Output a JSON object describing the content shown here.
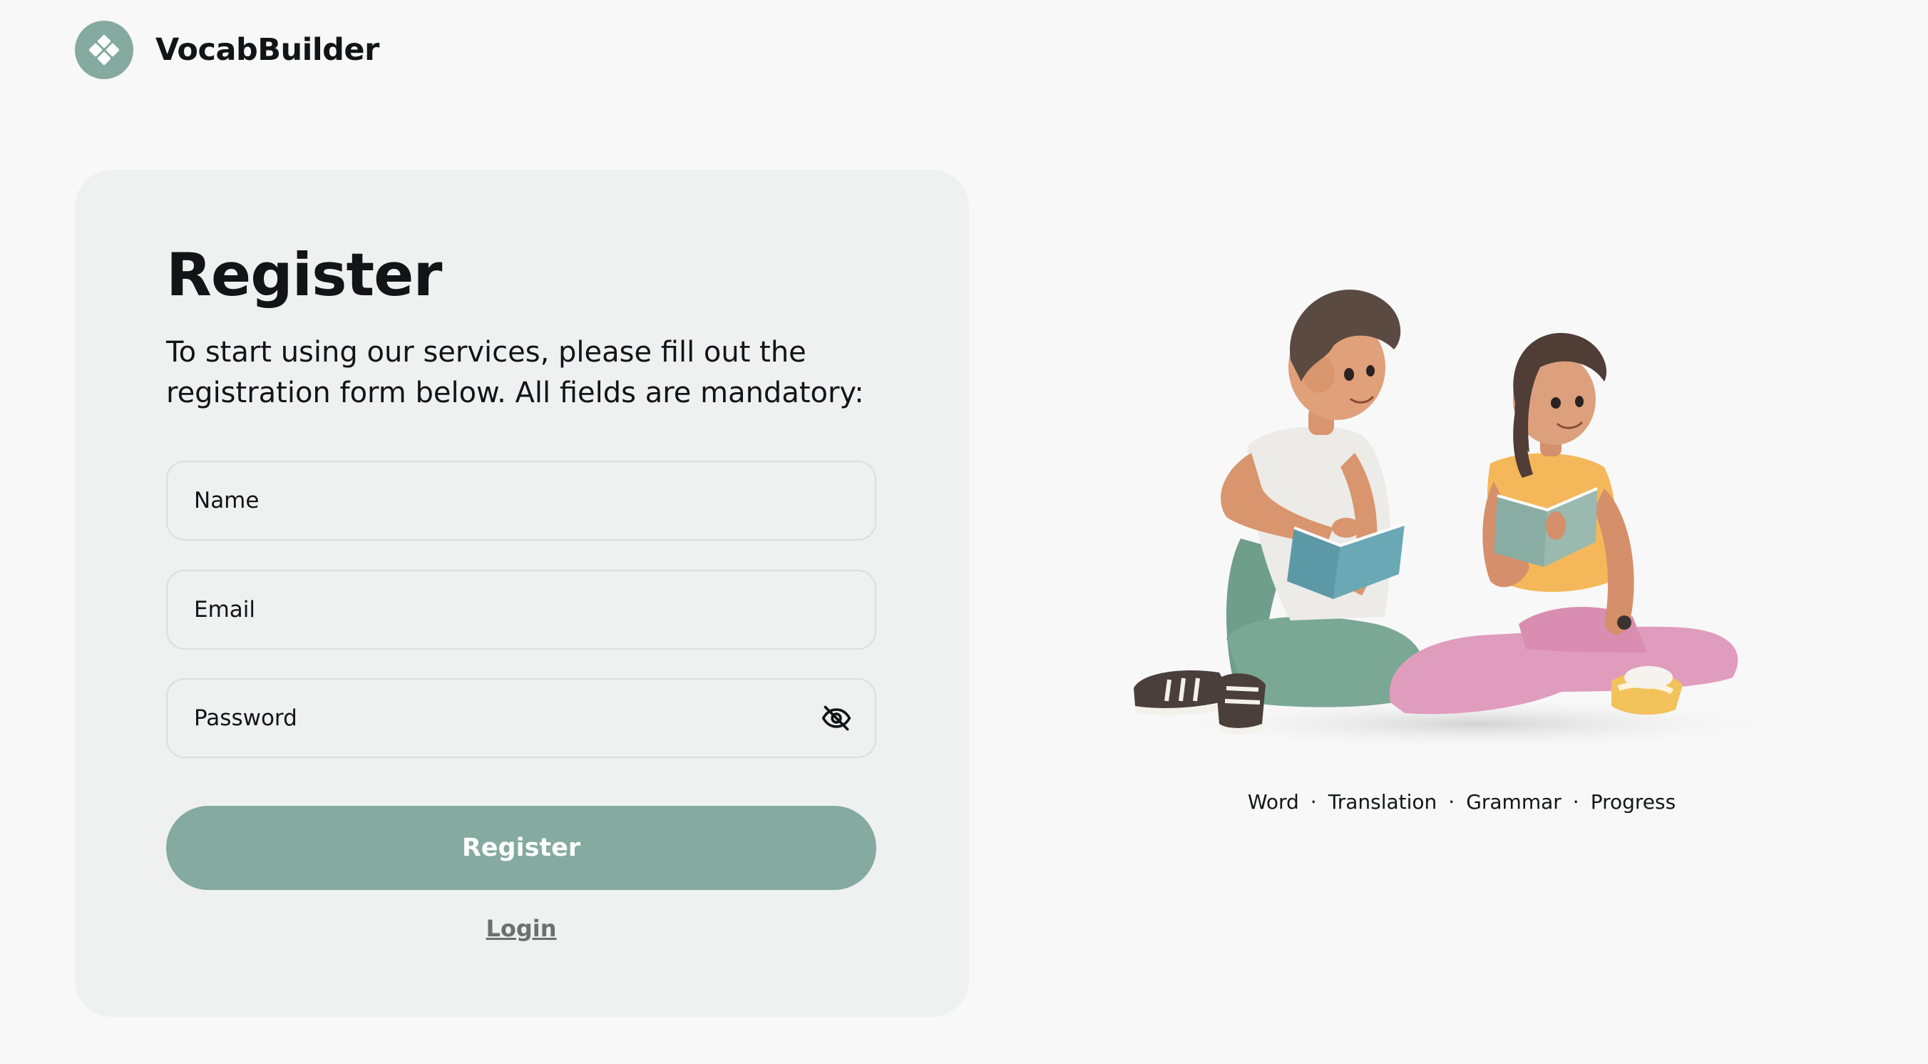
{
  "brand": {
    "name": "VocabBuilder",
    "logo_icon": "four-petal-logo-icon",
    "accent_color": "#85aa9f"
  },
  "form": {
    "title": "Register",
    "description": "To start using our services, please fill out the registration form below. All fields are mandatory:",
    "fields": {
      "name": {
        "placeholder": "Name",
        "value": ""
      },
      "email": {
        "placeholder": "Email",
        "value": ""
      },
      "password": {
        "placeholder": "Password",
        "value": "",
        "toggle_icon": "eye-off-icon"
      }
    },
    "submit_label": "Register",
    "login_label": "Login"
  },
  "hero": {
    "illustration": "two-students-reading-books-illustration",
    "tags": [
      "Word",
      "Translation",
      "Grammar",
      "Progress"
    ],
    "separator": "·"
  }
}
